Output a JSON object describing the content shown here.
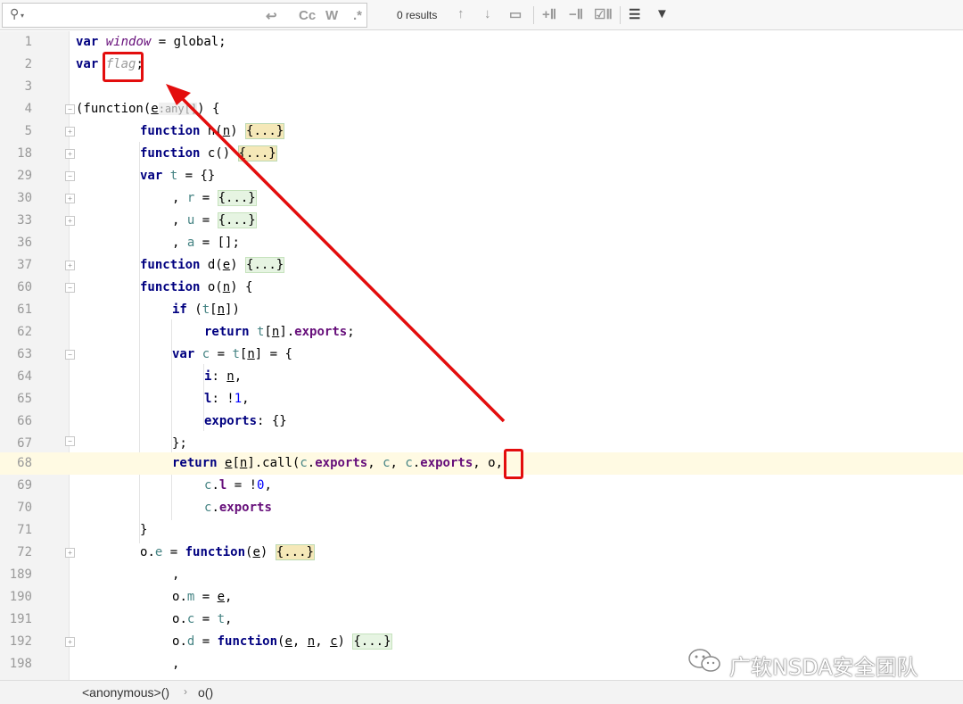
{
  "search": {
    "value": "",
    "placeholder": "",
    "results": "0 results",
    "match_case_label": "Cc",
    "words_label": "W",
    "regex_label": ".*"
  },
  "icons": {
    "search": "magnifier-icon",
    "newline": "newline-icon",
    "prev": "arrow-up-icon",
    "next": "arrow-down-icon",
    "select_all": "select-occurrences-icon",
    "add_occurrence": "add-occurrence-icon",
    "remove_occurrence": "remove-occurrence-icon",
    "select_all_occurrences": "select-all-occurrences-icon",
    "filter_settings": "list-filter-icon",
    "filter": "funnel-icon"
  },
  "lines": [
    {
      "n": "1"
    },
    {
      "n": "2"
    },
    {
      "n": "3"
    },
    {
      "n": "4"
    },
    {
      "n": "5"
    },
    {
      "n": "18"
    },
    {
      "n": "29"
    },
    {
      "n": "30"
    },
    {
      "n": "33"
    },
    {
      "n": "36"
    },
    {
      "n": "37"
    },
    {
      "n": "60"
    },
    {
      "n": "61"
    },
    {
      "n": "62"
    },
    {
      "n": "63"
    },
    {
      "n": "64"
    },
    {
      "n": "65"
    },
    {
      "n": "66"
    },
    {
      "n": "67"
    },
    {
      "n": "68"
    },
    {
      "n": "69"
    },
    {
      "n": "70"
    },
    {
      "n": "71"
    },
    {
      "n": "72"
    },
    {
      "n": "189"
    },
    {
      "n": "190"
    },
    {
      "n": "191"
    },
    {
      "n": "192"
    },
    {
      "n": "198"
    }
  ],
  "code": {
    "l1_kw": "var",
    "l1_var": "window",
    "l1_rest": " = global;",
    "l2_kw": "var",
    "l2_var": "flag",
    "l2_rest": ";",
    "l4_a": "(function(",
    "l4_e": "e",
    "l4_hint": ":any[]",
    "l4_b": ") {",
    "l5_kw": "function",
    "l5_name": " n(",
    "l5_p": "n",
    "l5_b": ") ",
    "l5_fold": "{...}",
    "l18_kw": "function",
    "l18_name": " c() ",
    "l18_fold": "{...}",
    "l29_kw": "var",
    "l29_t": " t",
    "l29_rest": " = {}",
    "l30_a": ", ",
    "l30_r": "r",
    "l30_b": " = ",
    "l30_fold": "{...}",
    "l33_a": ", ",
    "l33_u": "u",
    "l33_b": " = ",
    "l33_fold": "{...}",
    "l36_a": ", ",
    "l36_a2": "a",
    "l36_b": " = [];",
    "l37_kw": "function",
    "l37_name": " d(",
    "l37_p": "e",
    "l37_b": ") ",
    "l37_fold": "{...}",
    "l60_kw": "function",
    "l60_name": " o(",
    "l60_p": "n",
    "l60_b": ") {",
    "l61_kw": "if",
    "l61_a": " (",
    "l61_t": "t",
    "l61_b": "[",
    "l61_n": "n",
    "l61_c": "])",
    "l62_kw": "return",
    "l62_t": " t",
    "l62_a": "[",
    "l62_n": "n",
    "l62_b": "].",
    "l62_f": "exports",
    "l62_c": ";",
    "l63_kw": "var",
    "l63_c": " c",
    "l63_a": " = ",
    "l63_t": "t",
    "l63_b": "[",
    "l63_n": "n",
    "l63_d": "] = {",
    "l64_f": "i",
    "l64_a": ": ",
    "l64_n": "n",
    "l64_b": ",",
    "l65_f": "l",
    "l65_a": ": !",
    "l65_num": "1",
    "l65_b": ",",
    "l66_f": "exports",
    "l66_a": ": {}",
    "l67": "};",
    "l68_kw": "return",
    "l68_sp": " ",
    "l68_e": "e",
    "l68_a": "[",
    "l68_n": "n",
    "l68_b": "].call(",
    "l68_c1": "c",
    "l68_d1": ".",
    "l68_f1": "exports",
    "l68_s1": ", ",
    "l68_c2": "c",
    "l68_s2": ", ",
    "l68_c3": "c",
    "l68_d3": ".",
    "l68_f3": "exports",
    "l68_s3": ", ",
    "l68_o": "o",
    "l68_end": ",",
    "l69_c": "c",
    "l69_d": ".",
    "l69_f": "l",
    "l69_a": " = !",
    "l69_num": "0",
    "l69_b": ",",
    "l70_c": "c",
    "l70_d": ".",
    "l70_f": "exports",
    "l71": "}",
    "l72_o": "o",
    "l72_d": ".",
    "l72_e": "e",
    "l72_a": " = ",
    "l72_kw": "function",
    "l72_b": "(",
    "l72_p": "e",
    "l72_c": ") ",
    "l72_fold": "{...}",
    "l189": ",",
    "l190_o": "o",
    "l190_d": ".",
    "l190_m": "m",
    "l190_a": " = ",
    "l190_e": "e",
    "l190_b": ",",
    "l191_o": "o",
    "l191_d": ".",
    "l191_c": "c",
    "l191_a": " = ",
    "l191_t": "t",
    "l191_b": ",",
    "l192_o": "o",
    "l192_d": ".",
    "l192_dd": "d",
    "l192_a": " = ",
    "l192_kw": "function",
    "l192_b": "(",
    "l192_e": "e",
    "l192_s1": ", ",
    "l192_n": "n",
    "l192_s2": ", ",
    "l192_c": "c",
    "l192_cl": ") ",
    "l192_fold": "{...}",
    "l198": ","
  },
  "breadcrumb": {
    "items": [
      "<anonymous>()",
      "o()"
    ],
    "separator": "›"
  },
  "watermark": {
    "text": "广软NSDA安全团队",
    "logo": "wechat-logo-icon"
  },
  "colors": {
    "keyword": "#000080",
    "instance_field": "#660e7a",
    "local": "#458383",
    "number": "#0000ff",
    "current_line": "#fffae3",
    "annotation_red": "#e30d0d"
  }
}
